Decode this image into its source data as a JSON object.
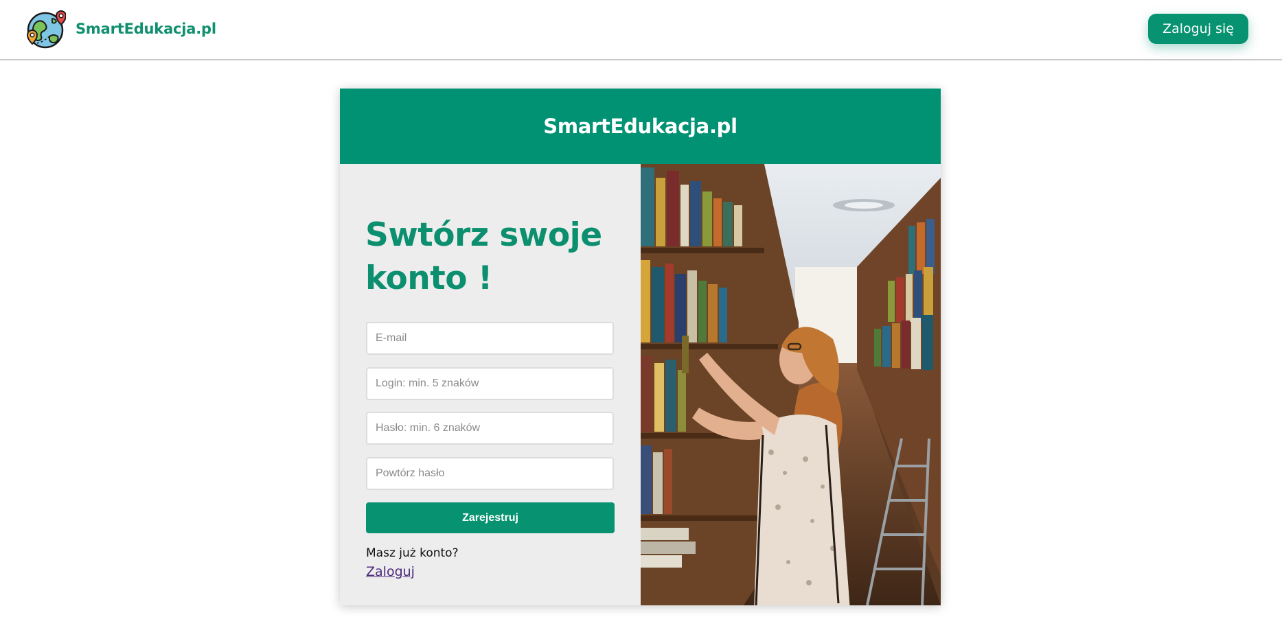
{
  "header": {
    "brand_name": "SmartEdukacja.pl",
    "login_button": "Zaloguj się"
  },
  "card": {
    "title": "SmartEdukacja.pl",
    "headline": "Swtórz swoje konto !",
    "fields": {
      "email_placeholder": "E-mail",
      "login_placeholder": "Login: min. 5 znaków",
      "password_placeholder": "Hasło: min. 6 znaków",
      "repeat_password_placeholder": "Powtórz hasło"
    },
    "register_button": "Zarejestruj",
    "have_account_text": "Masz już konto?",
    "login_link": "Zaloguj"
  },
  "colors": {
    "accent": "#079371",
    "header_bg": "#019274",
    "headline": "#0b8f6f",
    "panel_bg": "#ededed",
    "link": "#4b2a7b"
  },
  "icons": {
    "logo": "globe-with-map-pins-icon"
  }
}
